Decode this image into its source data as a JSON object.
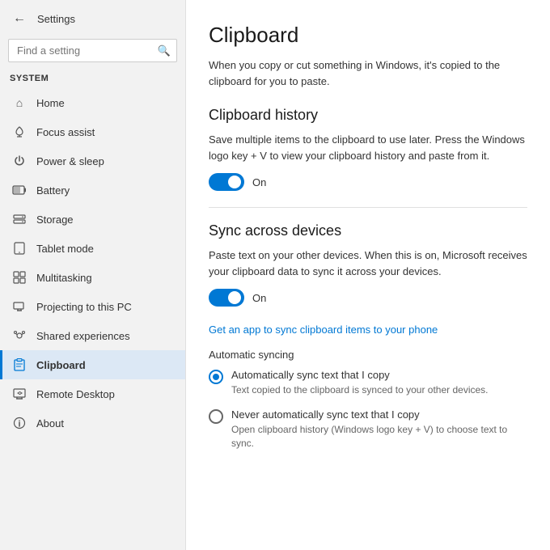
{
  "sidebar": {
    "app_title": "Settings",
    "search_placeholder": "Find a setting",
    "section_label": "System",
    "items": [
      {
        "id": "home",
        "label": "Home",
        "icon": "⌂",
        "active": false
      },
      {
        "id": "focus-assist",
        "label": "Focus assist",
        "icon": "🌙",
        "active": false
      },
      {
        "id": "power-sleep",
        "label": "Power & sleep",
        "icon": "⏻",
        "active": false
      },
      {
        "id": "battery",
        "label": "Battery",
        "icon": "🔋",
        "active": false
      },
      {
        "id": "storage",
        "label": "Storage",
        "icon": "💾",
        "active": false
      },
      {
        "id": "tablet-mode",
        "label": "Tablet mode",
        "icon": "⬜",
        "active": false
      },
      {
        "id": "multitasking",
        "label": "Multitasking",
        "icon": "▣",
        "active": false
      },
      {
        "id": "projecting",
        "label": "Projecting to this PC",
        "icon": "📺",
        "active": false
      },
      {
        "id": "shared-experiences",
        "label": "Shared experiences",
        "icon": "⚙",
        "active": false
      },
      {
        "id": "clipboard",
        "label": "Clipboard",
        "icon": "📋",
        "active": true
      },
      {
        "id": "remote-desktop",
        "label": "Remote Desktop",
        "icon": "🖥",
        "active": false
      },
      {
        "id": "about",
        "label": "About",
        "icon": "ℹ",
        "active": false
      }
    ]
  },
  "main": {
    "page_title": "Clipboard",
    "page_description": "When you copy or cut something in Windows, it's copied to the clipboard for you to paste.",
    "sections": [
      {
        "id": "clipboard-history",
        "title": "Clipboard history",
        "description": "Save multiple items to the clipboard to use later. Press the Windows logo key + V to view your clipboard history and paste from it.",
        "toggle": {
          "state": "on",
          "label": "On"
        }
      },
      {
        "id": "sync-across-devices",
        "title": "Sync across devices",
        "description": "Paste text on your other devices. When this is on, Microsoft receives your clipboard data to sync it across your devices.",
        "toggle": {
          "state": "on",
          "label": "On"
        },
        "link": "Get an app to sync clipboard items to your phone",
        "sub_section_label": "Automatic syncing",
        "radio_options": [
          {
            "id": "auto-sync",
            "checked": true,
            "main_text": "Automatically sync text that I copy",
            "sub_text": "Text copied to the clipboard is synced to your other devices."
          },
          {
            "id": "never-sync",
            "checked": false,
            "main_text": "Never automatically sync text that I copy",
            "sub_text": "Open clipboard history (Windows logo key + V) to choose text to sync."
          }
        ]
      }
    ]
  },
  "icons": {
    "back": "←",
    "search": "🔍",
    "home": "⌂",
    "focus_assist": ")",
    "power": "⏻",
    "battery": "▭",
    "storage": "▬",
    "tablet": "▢",
    "multitasking": "⧉",
    "projecting": "⊡",
    "shared": "⚙",
    "clipboard": "⎘",
    "remote": "⊞",
    "about": "ⓘ"
  }
}
